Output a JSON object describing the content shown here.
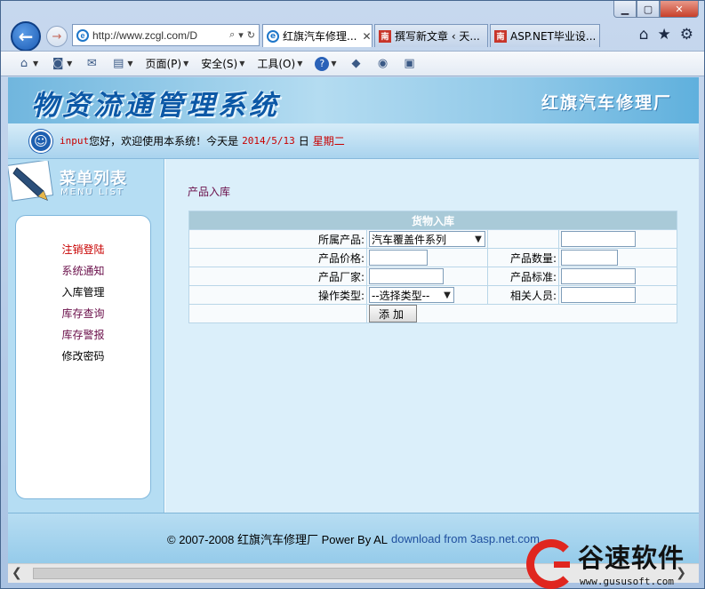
{
  "browser": {
    "address_url": "http://www.zcgl.com/D",
    "tabs": [
      {
        "label": "红旗汽车修理..."
      },
      {
        "label": "撰写新文章 ‹ 天..."
      },
      {
        "label": "ASP.NET毕业设..."
      }
    ],
    "tab_icon_text": "南",
    "ie_icon_text": "e",
    "window_buttons": {
      "minimize": "▁",
      "maximize": "▢",
      "close": "✕"
    }
  },
  "commandbar": {
    "page_label": "页面(P)",
    "safety_label": "安全(S)",
    "tools_label": "工具(O)"
  },
  "banner": {
    "system_title": "物资流通管理系统",
    "factory_name": "红旗汽车修理厂"
  },
  "welcome": {
    "user": "input",
    "greeting": "您好，欢迎使用本系统！今天是",
    "date": "2014/5/13",
    "day_label": "日",
    "weekday": "星期二"
  },
  "sidebar": {
    "title_cn": "菜单列表",
    "title_en": "MENU LIST",
    "items": [
      {
        "label": "注销登陆",
        "color": "#c80000"
      },
      {
        "label": "系统通知",
        "color": "#6a0f4a"
      },
      {
        "label": "入库管理",
        "color": "#000000"
      },
      {
        "label": "库存查询",
        "color": "#6a0f4a"
      },
      {
        "label": "库存警报",
        "color": "#6a0f4a"
      },
      {
        "label": "修改密码",
        "color": "#000000"
      }
    ]
  },
  "main": {
    "breadcrumb": "产品入库",
    "form": {
      "title": "货物入库",
      "product_label": "所属产品:",
      "product_selected": "汽车覆盖件系列",
      "product_extra_value": "",
      "price_label": "产品价格:",
      "price_value": "",
      "quantity_label": "产品数量:",
      "quantity_value": "",
      "manufacturer_label": "产品厂家:",
      "manufacturer_value": "",
      "standard_label": "产品标准:",
      "standard_value": "",
      "op_type_label": "操作类型:",
      "op_type_selected": "--选择类型--",
      "person_label": "相关人员:",
      "person_value": "",
      "submit_label": "添加"
    }
  },
  "footer": {
    "copyright": "© 2007-2008 红旗汽车修理厂 Power By AL",
    "link": "download from 3asp.net.com"
  },
  "watermark": {
    "name": "谷速软件",
    "url": "www.gususoft.com"
  },
  "colors": {
    "accent_red": "#c80000",
    "link_purple": "#6a0f4a",
    "banner_blue": "#0c58a6",
    "panel_blue": "#b5ddf3"
  }
}
